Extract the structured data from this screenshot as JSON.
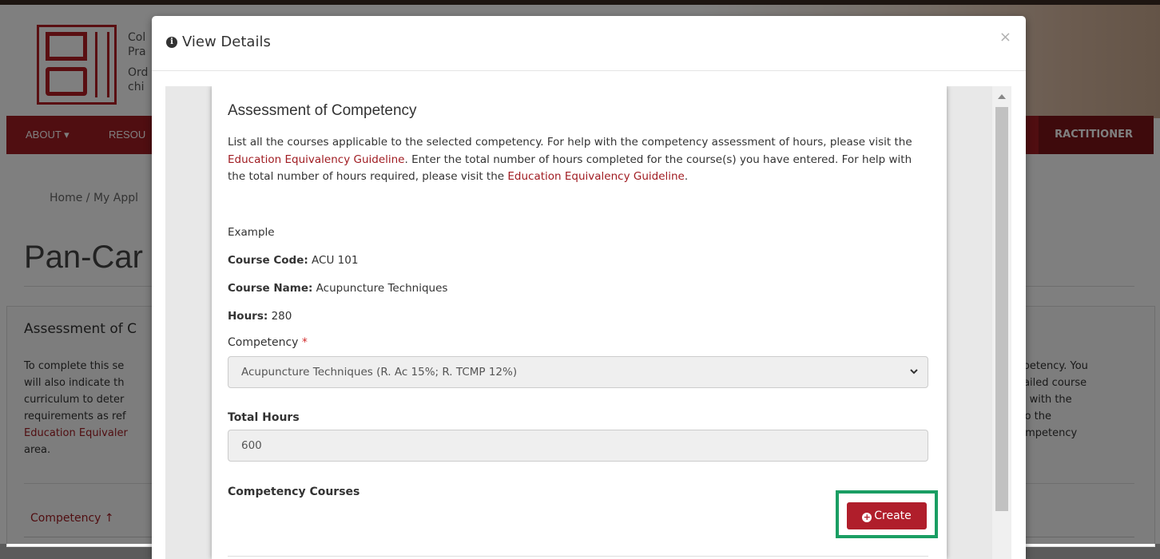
{
  "background": {
    "org_lines": [
      "Col",
      "Pra",
      "Ord",
      "chi"
    ],
    "nav_items": [
      "ABOUT ▾",
      "RESOU"
    ],
    "nav_right": "RACTITIONER",
    "breadcrumb": "Home  /  My Appl",
    "page_title": "Pan-Car",
    "section_title": "Assessment of C",
    "left_text_lines": [
      "To complete this se",
      "will also indicate th",
      "curriculum to deter",
      "requirements as ref",
      "Education Equivaler",
      "area."
    ],
    "right_text_lines": [
      "mpetency. You",
      "etailed course",
      "gn with the",
      "r to the",
      "competency"
    ],
    "competency_column": "Competency"
  },
  "modal": {
    "title": "View Details",
    "close_symbol": "×",
    "heading": "Assessment of Competency",
    "intro": {
      "part1": "List all the courses applicable to the selected competency. For help with the competency assessment of hours, please visit the ",
      "link1": "Education Equivalency Guideline",
      "part2": ". Enter the total number of hours completed for the course(s) you have entered. For help with the total number of hours required, please visit the ",
      "link2": "Education Equivalency Guideline",
      "part3": "."
    },
    "example_label": "Example",
    "course_code_label": "Course Code:",
    "course_code_value": " ACU 101",
    "course_name_label": "Course Name:",
    "course_name_value": " Acupuncture Techniques",
    "hours_label": "Hours:",
    "hours_value": " 280",
    "competency_label": "Competency",
    "required_mark": "*",
    "competency_selected": "Acupuncture Techniques (R. Ac 15%; R. TCMP 12%)",
    "total_hours_label": "Total Hours",
    "total_hours_value": "600",
    "competency_courses_label": "Competency Courses",
    "create_button": "Create"
  }
}
